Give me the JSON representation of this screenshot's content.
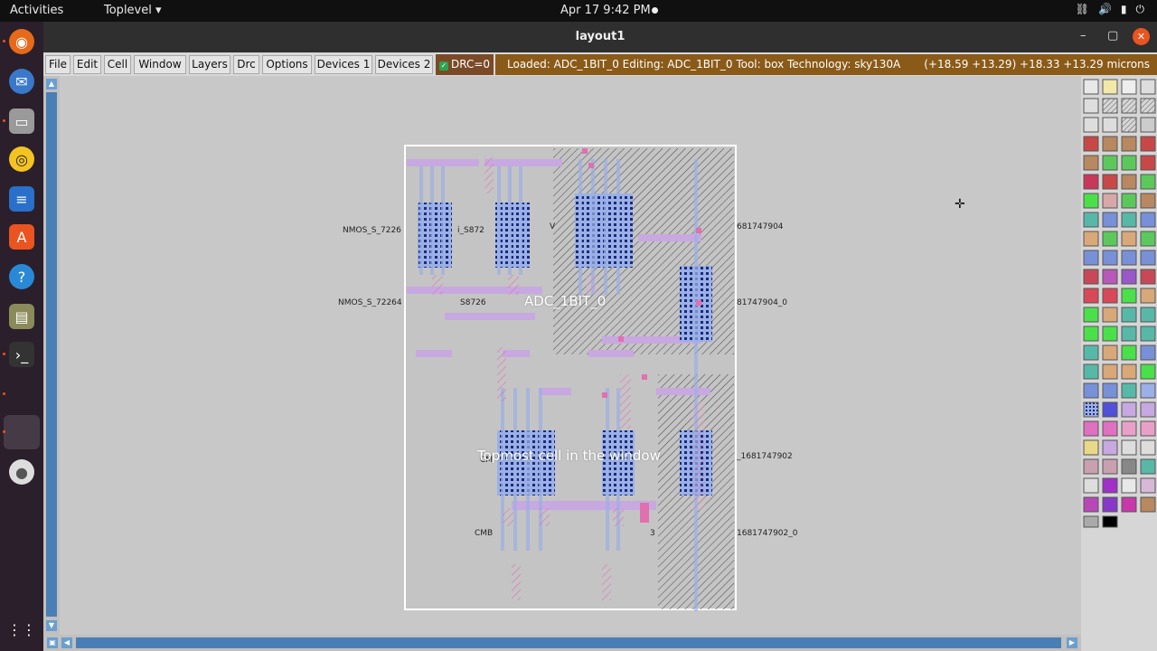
{
  "topbar": {
    "activities": "Activities",
    "app_menu": "Toplevel",
    "clock": "Apr 17  9:42 PM"
  },
  "window": {
    "title": "layout1",
    "min_glyph": "–",
    "max_glyph": "▢",
    "close_glyph": "✕"
  },
  "menubar": {
    "items": [
      "File",
      "Edit",
      "Cell",
      "Window",
      "Layers",
      "Drc",
      "Options",
      "Devices 1",
      "Devices 2"
    ],
    "drc": "DRC=0",
    "status": "Loaded: ADC_1BIT_0  Editing: ADC_1BIT_0  Tool: box  Technology: sky130A",
    "coords": "(+18.59 +13.29) +18.33 +13.29 microns"
  },
  "layout": {
    "cell_name": "ADC_1BIT_0",
    "tooltip": "Topmost cell in the window",
    "labels": {
      "nmos1": "NMOS_S_7226",
      "nmos2": "NMOS_S_72264",
      "sub1": "i_S872",
      "sub2": "S8726",
      "right1": "681747904",
      "right2": "81747904_0",
      "right3": "_1681747902",
      "right4": "1681747902_0",
      "cmb": "CMB",
      "cm": "CM",
      "v": "V",
      "three": "3"
    }
  },
  "colors": {
    "accent": "#e95420",
    "status_bg": "#8a5a18",
    "drc_bg": "#7a4a28",
    "scroll": "#4a7fb5"
  }
}
